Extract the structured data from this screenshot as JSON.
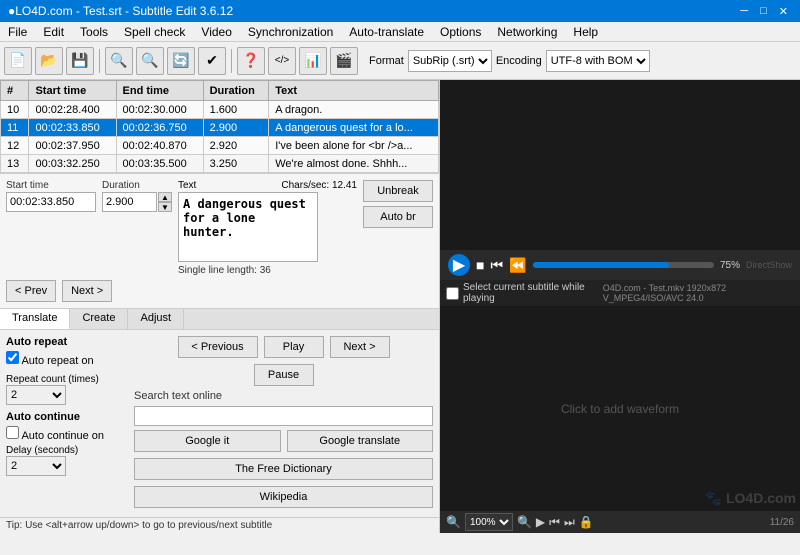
{
  "titlebar": {
    "title": "●LO4D.com - Test.srt - Subtitle Edit 3.6.12",
    "min": "─",
    "max": "□",
    "close": "✕"
  },
  "menubar": {
    "items": [
      "File",
      "Edit",
      "Tools",
      "Spell check",
      "Video",
      "Synchronization",
      "Auto-translate",
      "Options",
      "Networking",
      "Help"
    ]
  },
  "toolbar": {
    "format_label": "Format",
    "format_value": "SubRip (.srt)",
    "encoding_label": "Encoding",
    "encoding_value": "UTF-8 with BOM",
    "buttons": [
      "📄",
      "📂",
      "💾",
      "🔍",
      "🔍",
      "🔄",
      "✔",
      "❓",
      "</>",
      "📊",
      "🎬"
    ]
  },
  "table": {
    "columns": [
      "#",
      "Start time",
      "End time",
      "Duration",
      "Text"
    ],
    "rows": [
      {
        "num": "10",
        "start": "00:02:28.400",
        "end": "00:02:30.000",
        "duration": "1.600",
        "text": "A dragon.",
        "selected": false
      },
      {
        "num": "11",
        "start": "00:02:33.850",
        "end": "00:02:36.750",
        "duration": "2.900",
        "text": "A dangerous quest for a lo...",
        "selected": true
      },
      {
        "num": "12",
        "start": "00:02:37.950",
        "end": "00:02:40.870",
        "duration": "2.920",
        "text": "I've been alone for <br />a...",
        "selected": false
      },
      {
        "num": "13",
        "start": "00:03:32.250",
        "end": "00:03:35.500",
        "duration": "3.250",
        "text": "We're almost done. Shhh...",
        "selected": false
      }
    ]
  },
  "edit": {
    "start_label": "Start time",
    "start_value": "00:02:33.850",
    "duration_label": "Duration",
    "duration_value": "2.900",
    "text_header": "Text",
    "chars_label": "Chars/sec: 12.41",
    "text_content": "A dangerous quest for a lone hunter.",
    "single_line_label": "Single line length: 36",
    "unbreak_label": "Unbreak",
    "auto_br_label": "Auto br",
    "prev_label": "< Prev",
    "next_label": "Next >"
  },
  "video": {
    "progress_pct": "75%",
    "progress_label": "75%",
    "directshow": "DirectShow",
    "waveform_label": "Click to add waveform",
    "checkbox_label": "Select current subtitle while playing",
    "video_info": "O4D.com - Test.mkv 1920x872 V_MPEG4/ISO/AVC 24.0",
    "zoom_value": "100%",
    "counter": "11/26"
  },
  "bottom": {
    "tabs": [
      "Translate",
      "Create",
      "Adjust"
    ],
    "active_tab": "Translate",
    "auto_repeat_label": "Auto repeat",
    "auto_repeat_on_label": "Auto repeat on",
    "repeat_count_label": "Repeat count (times)",
    "repeat_count_value": "2",
    "auto_continue_label": "Auto continue",
    "auto_continue_on_label": "Auto continue on",
    "delay_label": "Delay (seconds)",
    "delay_value": "2",
    "prev_btn": "< Previous",
    "play_btn": "Play",
    "next_btn": "Next >",
    "pause_btn": "Pause",
    "search_label": "Search text online",
    "google_btn": "Google it",
    "google_translate_btn": "Google translate",
    "dictionary_btn": "The Free Dictionary",
    "wikipedia_btn": "Wikipedia",
    "tip": "Tip: Use <alt+arrow up/down> to go to previous/next subtitle"
  }
}
